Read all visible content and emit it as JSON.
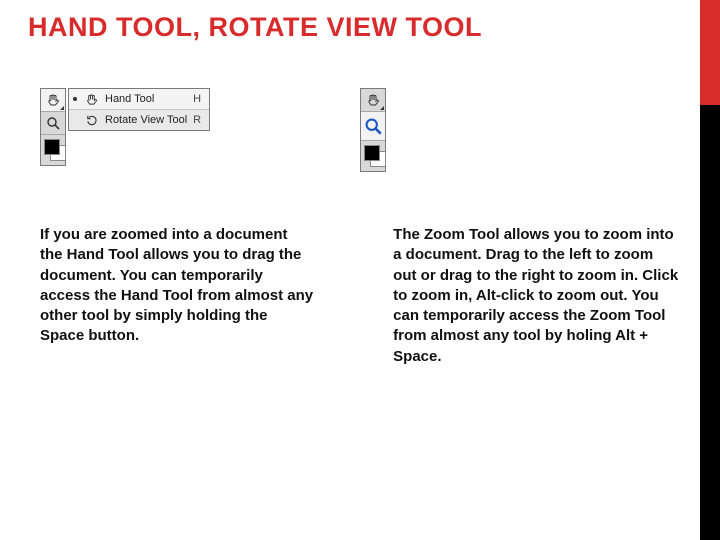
{
  "title": "HAND TOOL, ROTATE VIEW TOOL",
  "left_fig": {
    "flyout": [
      {
        "label": "Hand Tool",
        "shortcut": "H"
      },
      {
        "label": "Rotate View Tool",
        "shortcut": "R"
      }
    ]
  },
  "columns": {
    "left": "If you are zoomed into a document the Hand Tool allows you to drag the document. You can temporarily access the Hand Tool from almost any other tool by simply holding the Space button.",
    "right": "The Zoom Tool allows you to zoom into a document. Drag to the left to zoom out or drag to the right to zoom in. Click to zoom in, Alt-click to zoom out. You can temporarily access the Zoom Tool from almost any tool by holing Alt + Space."
  }
}
